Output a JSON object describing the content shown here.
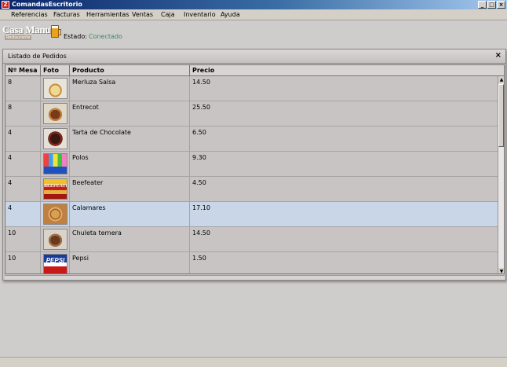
{
  "window": {
    "title": "ComandasEscritorio",
    "minimize": "_",
    "maximize": "□",
    "close": "×"
  },
  "menu": [
    "Referencias",
    "Facturas",
    "Herramientas",
    "Ventas",
    "Caja",
    "Inventario",
    "Ayuda"
  ],
  "logo": {
    "name": "Casa Manuel",
    "subtitle": "Restaurante"
  },
  "estado": {
    "label": "Estado:",
    "value": "Conectado"
  },
  "panel": {
    "title": "Listado de Pedidos",
    "close": "×",
    "columns": [
      "Nº Mesa",
      "Foto",
      "Producto",
      "Precio"
    ],
    "rows": [
      {
        "mesa": "8",
        "foto": "merluza",
        "producto": "Merluza Salsa",
        "precio": "14.50"
      },
      {
        "mesa": "8",
        "foto": "entrecot",
        "producto": "Entrecot",
        "precio": "25.50"
      },
      {
        "mesa": "4",
        "foto": "tarta",
        "producto": "Tarta de Chocolate",
        "precio": "6.50"
      },
      {
        "mesa": "4",
        "foto": "polos",
        "producto": "Polos",
        "precio": "9.30"
      },
      {
        "mesa": "4",
        "foto": "beefeater",
        "producto": "Beefeater",
        "precio": "4.50",
        "photo_text": "BEEFEATER"
      },
      {
        "mesa": "4",
        "foto": "calamares",
        "producto": "Calamares",
        "precio": "17.10",
        "selected": true
      },
      {
        "mesa": "10",
        "foto": "chuleta",
        "producto": "Chuleta ternera",
        "precio": "14.50"
      },
      {
        "mesa": "10",
        "foto": "pepsi",
        "producto": "Pepsi",
        "precio": "1.50",
        "photo_text": "PEPSI"
      }
    ]
  },
  "scrollbar": {
    "up": "▲",
    "down": "▼"
  },
  "colors": {
    "selected_row": "#c8d6e8",
    "estado": "#3a8a5a",
    "titlebar": "#0a246a"
  }
}
